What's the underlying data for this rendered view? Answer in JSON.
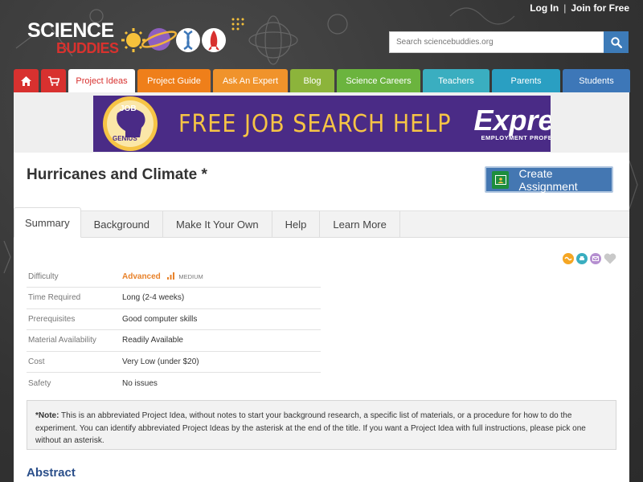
{
  "header": {
    "login_label": "Log In",
    "separator": "|",
    "join_label": "Join for Free",
    "logo_word1": "SCIENCE",
    "logo_word2": "BUDDIES",
    "search_placeholder": "Search sciencebuddies.org"
  },
  "nav": {
    "items": [
      {
        "label": "Project Ideas",
        "color": "#ffffff",
        "active": true
      },
      {
        "label": "Project Guide",
        "color": "#ef7f1a"
      },
      {
        "label": "Ask An Expert",
        "color": "#f0932b"
      },
      {
        "label": "Blog",
        "color": "#8cb43b"
      },
      {
        "label": "Science Careers",
        "color": "#6bb43e"
      },
      {
        "label": "Teachers",
        "color": "#3aaec0"
      },
      {
        "label": "Parents",
        "color": "#2a9fc2"
      },
      {
        "label": "Students",
        "color": "#3d77b8"
      }
    ],
    "home_icon": "home-icon",
    "cart_icon": "cart-icon"
  },
  "ad": {
    "badge_line1": "JOB",
    "badge_line2": "GENIUS",
    "headline": "FREE JOB SEARCH HELP",
    "brand": "Express",
    "brand_sub": "EMPLOYMENT PROFESSIONALS"
  },
  "page": {
    "title": "Hurricanes and Climate *",
    "create_button": "Create Assignment"
  },
  "content_tabs": [
    "Summary",
    "Background",
    "Make It Your Own",
    "Help",
    "Learn More"
  ],
  "facts": {
    "difficulty_label": "Difficulty",
    "difficulty_value": "Advanced",
    "difficulty_sub": "MEDIUM",
    "rows": [
      {
        "label": "Time Required",
        "value": "Long (2-4 weeks)"
      },
      {
        "label": "Prerequisites",
        "value": "Good computer skills"
      },
      {
        "label": "Material Availability",
        "value": "Readily Available"
      },
      {
        "label": "Cost",
        "value": "Very Low (under $20)"
      },
      {
        "label": "Safety",
        "value": "No issues"
      }
    ]
  },
  "note": {
    "prefix": "*Note:",
    "text": " This is an abbreviated Project Idea, without notes to start your background research, a specific list of materials, or a procedure for how to do the experiment. You can identify abbreviated Project Ideas by the asterisk at the end of the title. If you want a Project Idea with full instructions, please pick one without an asterisk."
  },
  "abstract_heading": "Abstract"
}
